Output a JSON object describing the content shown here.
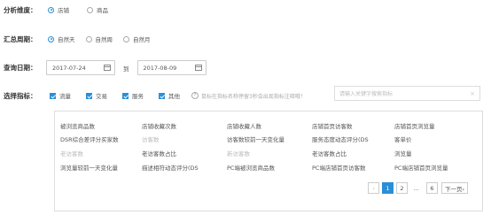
{
  "dimension": {
    "label": "分析维度：",
    "options": [
      {
        "text": "店铺",
        "checked": true
      },
      {
        "text": "商品",
        "checked": false
      }
    ]
  },
  "period": {
    "label": "汇总周期：",
    "options": [
      {
        "text": "自然天",
        "checked": true
      },
      {
        "text": "自然周",
        "checked": false
      },
      {
        "text": "自然月",
        "checked": false
      }
    ]
  },
  "date_range": {
    "label": "查询日期：",
    "start": "2017-07-24",
    "separator": "到",
    "end": "2017-08-09"
  },
  "metrics": {
    "label": "选择指标：",
    "checks": [
      "流量",
      "交易",
      "服务",
      "其他"
    ],
    "hint": "鼠标在指标名称停留3秒会出现指标注释哦！",
    "search_placeholder": "请输入关键字搜索指标"
  },
  "metric_grid": [
    [
      {
        "t": "被浏览商品数",
        "d": false
      },
      {
        "t": "店铺收藏次数",
        "d": false
      },
      {
        "t": "店铺收藏人数",
        "d": false
      },
      {
        "t": "店铺首页访客数",
        "d": false
      },
      {
        "t": "店铺首页浏览量",
        "d": false
      }
    ],
    [
      {
        "t": "DSR综合差评分买家数",
        "d": false
      },
      {
        "t": "访客数",
        "d": true
      },
      {
        "t": "访客数较前一天变化量",
        "d": false
      },
      {
        "t": "服务态度动态评分(DS",
        "d": false
      },
      {
        "t": "客单价",
        "d": false
      }
    ],
    [
      {
        "t": "老访客数",
        "d": true
      },
      {
        "t": "老访客数占比",
        "d": false
      },
      {
        "t": "新访客数",
        "d": true
      },
      {
        "t": "老访客数占比",
        "d": false
      },
      {
        "t": "浏览量",
        "d": false
      }
    ],
    [
      {
        "t": "浏览量较前一天变化量",
        "d": false
      },
      {
        "t": "描述相符动态评分(DS",
        "d": false
      },
      {
        "t": "PC端被浏览商品数",
        "d": false
      },
      {
        "t": "PC端店铺首页访客数",
        "d": false
      },
      {
        "t": "PC端店铺首页浏览量",
        "d": false
      }
    ]
  ],
  "pagination": {
    "prev": "‹",
    "pages": [
      "1",
      "2",
      "...",
      "6"
    ],
    "current": "1",
    "next": "下一页›"
  }
}
